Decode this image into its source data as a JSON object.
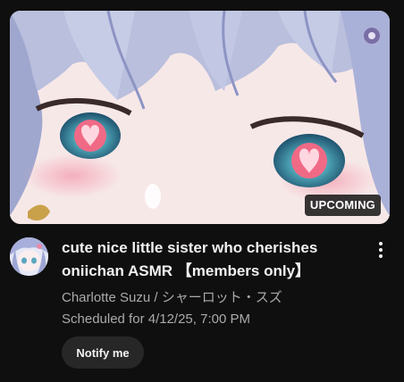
{
  "video": {
    "badge": "UPCOMING",
    "title_line1": "cute nice little sister who cherishes",
    "title_line2": "oniichan ASMR 【members only】",
    "channel": "Charlotte Suzu / シャーロット・スズ",
    "scheduled": "Scheduled for 4/12/25, 7:00 PM",
    "notify_label": "Notify me"
  },
  "icons": {
    "menu": "more-vert-icon"
  },
  "colors": {
    "background": "#0f0f0f",
    "text_primary": "#f1f1f1",
    "text_secondary": "#aaaaaa",
    "button_bg": "#272727"
  }
}
